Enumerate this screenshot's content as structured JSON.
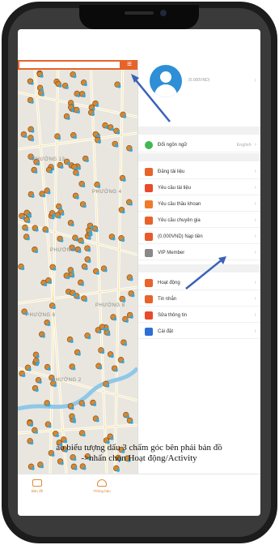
{
  "panel": {
    "balance": "(0.000VND)",
    "language": {
      "label": "Đổi ngôn ngữ",
      "value": "English"
    },
    "menu_group1": [
      {
        "label": "Đăng tải liệu",
        "icon": "upload-icon",
        "color": "#e8632a"
      },
      {
        "label": "Yêu cầu tài liệu",
        "icon": "document-icon",
        "color": "#e84a2a"
      },
      {
        "label": "Yêu cầu thầu khoan",
        "icon": "drill-icon",
        "color": "#f07a2a"
      },
      {
        "label": "Yêu cầu chuyên gia",
        "icon": "lifebuoy-icon",
        "color": "#e8632a"
      },
      {
        "label": "(0.000VND) Nạp tiền",
        "icon": "wallet-icon",
        "color": "#e85a2a"
      },
      {
        "label": "VIP Member",
        "icon": "vip-icon",
        "color": "#888888"
      }
    ],
    "menu_group2": [
      {
        "label": "Hoạt động",
        "icon": "activity-icon",
        "color": "#e8632a"
      },
      {
        "label": "Tin nhắn",
        "icon": "bell-icon",
        "color": "#e8632a"
      },
      {
        "label": "Sửa thông tin",
        "icon": "edit-icon",
        "color": "#e84a2a"
      },
      {
        "label": "Cài đặt",
        "icon": "gear-icon",
        "color": "#2e6fd6"
      }
    ]
  },
  "map": {
    "labels": [
      "PHƯỜNG 13",
      "PHƯỜNG 4",
      "PHƯỜNG 8",
      "PHƯỜNG 5",
      "PHƯỜNG 2",
      "PHƯỜNG 6"
    ]
  },
  "caption": {
    "line1": "ào biểu tượng dấu 3 chấm góc bên phải bản đồ",
    "line2": "->nhấn chọn Hoạt động/Activity"
  },
  "bottom_nav": [
    {
      "label": "Bản đồ",
      "icon": "map-icon"
    },
    {
      "label": "Thông báo",
      "icon": "bell-icon"
    }
  ],
  "colors": {
    "accent": "#e8632a",
    "arrow": "#3a62b8",
    "avatar": "#2e8fd6"
  }
}
